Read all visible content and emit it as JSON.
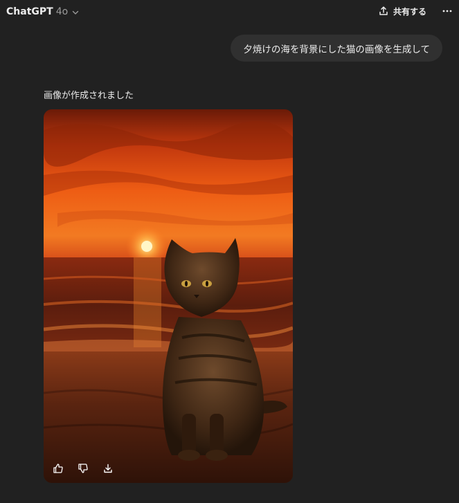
{
  "header": {
    "model_name": "ChatGPT",
    "model_version": "4o",
    "share_label": "共有する"
  },
  "conversation": {
    "user_message": "夕焼けの海を背景にした猫の画像を生成して",
    "assistant_status": "画像が作成されました"
  },
  "icons": {
    "model_dropdown": "chevron-down-icon",
    "share": "upload-icon",
    "more": "more-horizontal-icon",
    "like": "thumbs-up-icon",
    "dislike": "thumbs-down-icon",
    "download": "download-icon"
  },
  "colors": {
    "background": "#212121",
    "bubble": "#303030",
    "text": "#ececec",
    "muted": "#9b9b9b"
  }
}
